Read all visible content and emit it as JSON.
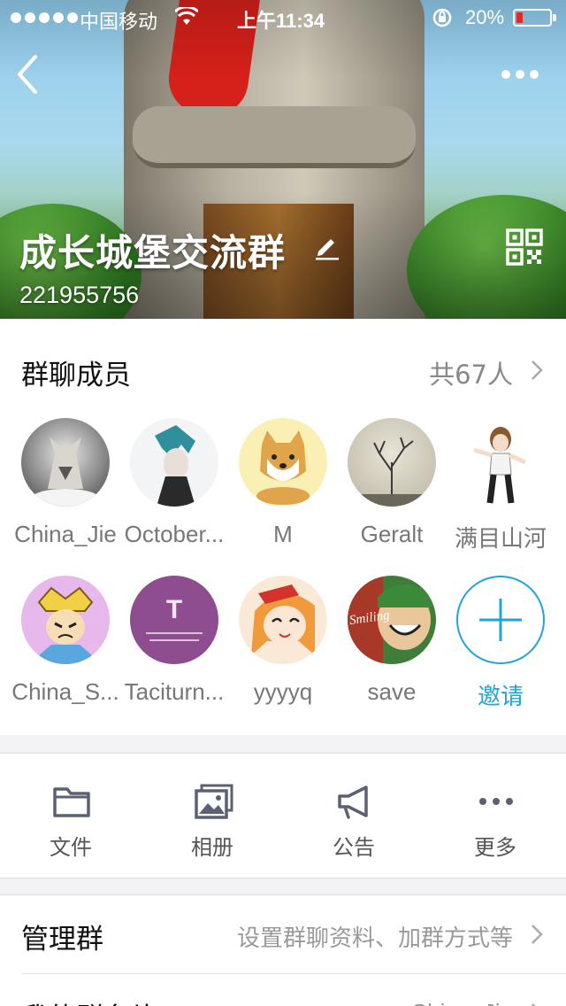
{
  "status_bar": {
    "carrier": "中国移动",
    "time": "上午11:34",
    "battery": "20%",
    "battery_level": 0.2
  },
  "header": {
    "group_name": "成长城堡交流群",
    "group_id": "221955756",
    "back_icon": "chevron-left-icon",
    "more_icon": "ellipsis-icon",
    "edit_icon": "pencil-icon",
    "qr_icon": "qr-code-icon"
  },
  "members": {
    "title": "群聊成员",
    "count": "共67人",
    "list": [
      {
        "name": "China_Jie"
      },
      {
        "name": "October..."
      },
      {
        "name": "M"
      },
      {
        "name": "Geralt"
      },
      {
        "name": "满目山河"
      },
      {
        "name": "China_S..."
      },
      {
        "name": "Taciturn..."
      },
      {
        "name": "yyyyq"
      },
      {
        "name": "save"
      }
    ],
    "invite_label": "邀请",
    "avatar_texts": {
      "taciturn_letter": "T",
      "smiling": "Smiling"
    }
  },
  "tools": [
    {
      "label": "文件",
      "icon": "folder-icon"
    },
    {
      "label": "相册",
      "icon": "photo-album-icon"
    },
    {
      "label": "公告",
      "icon": "megaphone-icon"
    },
    {
      "label": "更多",
      "icon": "more-icon"
    }
  ],
  "rows": [
    {
      "title": "管理群",
      "value": "设置群聊资料、加群方式等"
    },
    {
      "title": "我的群名片",
      "value": "China_Jie"
    }
  ],
  "colors": {
    "accent": "#1fa4dd",
    "battery_low": "#e8262a"
  }
}
